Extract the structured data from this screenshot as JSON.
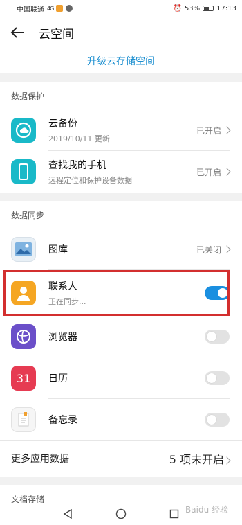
{
  "status_bar": {
    "carrier": "中国联通",
    "signal": "4G",
    "battery_pct": "53%",
    "time": "17:13"
  },
  "header": {
    "title": "云空间"
  },
  "upgrade": {
    "label": "升级云存储空间"
  },
  "data_protection": {
    "title": "数据保护",
    "items": [
      {
        "icon": "cloud-backup-icon",
        "title": "云备份",
        "subtitle": "2019/10/11 更新",
        "status": "已开启"
      },
      {
        "icon": "find-phone-icon",
        "title": "查找我的手机",
        "subtitle": "远程定位和保护设备数据",
        "status": "已开启"
      }
    ]
  },
  "data_sync": {
    "title": "数据同步",
    "items": [
      {
        "icon": "gallery-icon",
        "title": "图库",
        "status": "已关闭"
      },
      {
        "icon": "contacts-icon",
        "title": "联系人",
        "subtitle": "正在同步...",
        "toggle_on": true
      },
      {
        "icon": "browser-icon",
        "title": "浏览器",
        "toggle_on": false
      },
      {
        "icon": "calendar-icon",
        "title": "日历",
        "calendar_day": "31",
        "toggle_on": false
      },
      {
        "icon": "notepad-icon",
        "title": "备忘录",
        "toggle_on": false
      }
    ],
    "more": {
      "label": "更多应用数据",
      "status": "5 项未开启"
    }
  },
  "doc_storage": {
    "title": "文档存储"
  },
  "watermark": "Baidu 经验"
}
